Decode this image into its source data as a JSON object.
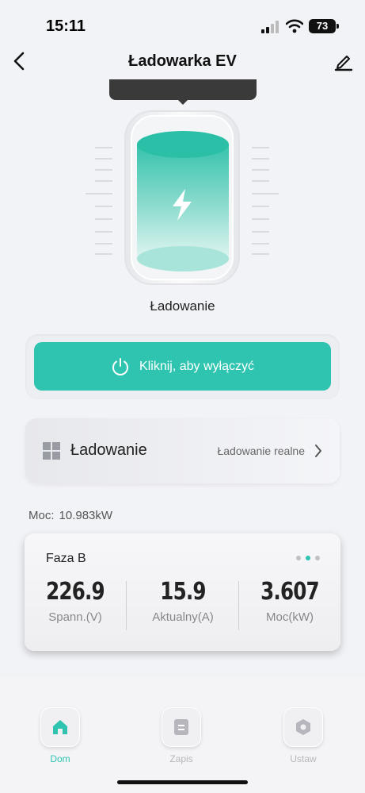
{
  "status_bar": {
    "time": "15:11",
    "battery": "73"
  },
  "nav": {
    "title": "Ładowarka EV",
    "back_icon": "chevron-left-icon",
    "edit_icon": "pencil-icon"
  },
  "charger": {
    "status": "Ładowanie",
    "icon": "lightning-icon",
    "accent_color": "#2ec4b0"
  },
  "power_button": {
    "label": "Kliknij, aby wyłączyć",
    "icon": "power-icon"
  },
  "mode": {
    "title": "Ładowanie",
    "value": "Ładowanie realne",
    "icon": "grid-icon"
  },
  "power_readout": {
    "label": "Moc:",
    "value": "10.983kW"
  },
  "phase": {
    "name": "Faza B",
    "metrics": [
      {
        "value": "226.9",
        "label": "Spann.(V)"
      },
      {
        "value": "15.9",
        "label": "Aktualny(A)"
      },
      {
        "value": "3.607",
        "label": "Moc(kW)"
      }
    ]
  },
  "tabs": [
    {
      "label": "Dom",
      "icon": "home-icon",
      "active": true,
      "color": "#2ec4b0"
    },
    {
      "label": "Zapis",
      "icon": "document-icon",
      "active": false,
      "color": "#b6b6bc"
    },
    {
      "label": "Ustaw",
      "icon": "hexagon-gear-icon",
      "active": false,
      "color": "#b6b6bc"
    }
  ]
}
